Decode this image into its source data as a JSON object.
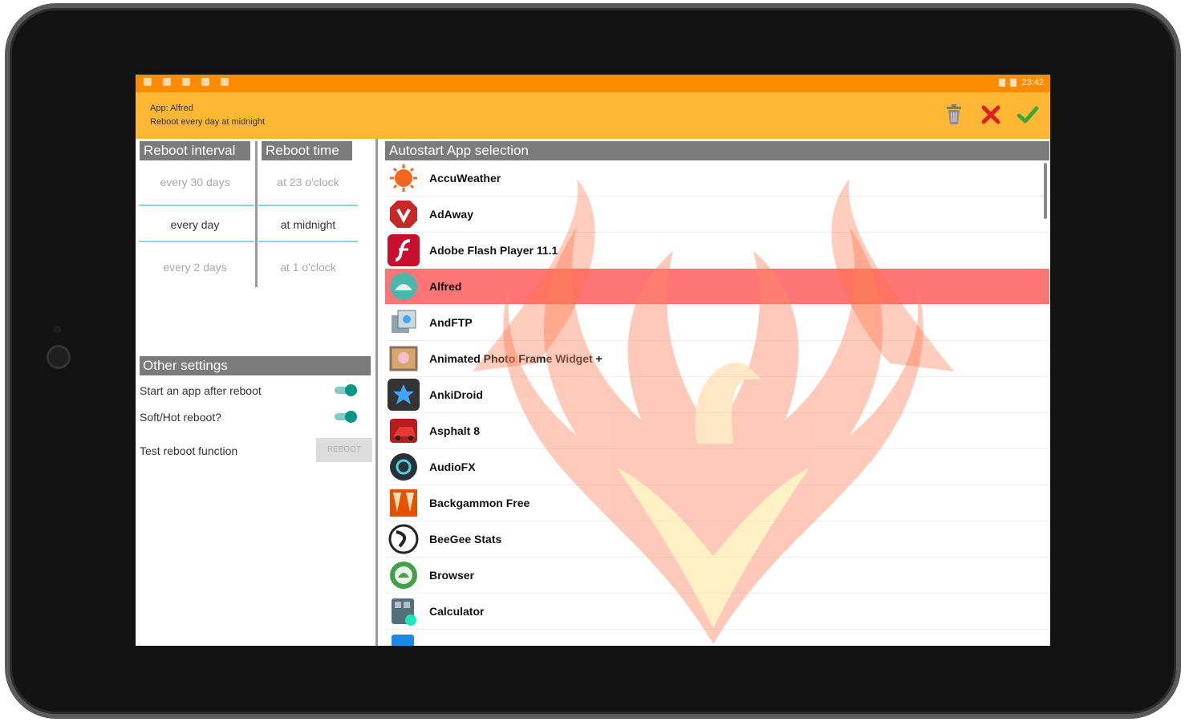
{
  "status_bar": {
    "time": "23:42"
  },
  "app_bar": {
    "line1": "App: Alfred",
    "line2": "Reboot every day at midnight",
    "actions": [
      "trash-icon",
      "close-icon",
      "check-icon"
    ],
    "colors": {
      "status": "#ff8c00",
      "toolbar": "#ffb734"
    }
  },
  "reboot_interval": {
    "header": "Reboot interval",
    "items": [
      "every 30 days",
      "every day",
      "every 2 days"
    ],
    "selected": "every day"
  },
  "reboot_time": {
    "header": "Reboot time",
    "items": [
      "at 23 o'clock",
      "at midnight",
      "at 1 o'clock"
    ],
    "selected": "at midnight"
  },
  "other_settings": {
    "header": "Other settings",
    "start_app_label": "Start an app after reboot",
    "soft_hot_label": "Soft/Hot reboot?",
    "test_label": "Test reboot function",
    "reboot_button": "REBOOT",
    "toggle_start_app": true,
    "toggle_soft_hot": true
  },
  "autostart": {
    "header": "Autostart App selection",
    "selected": "Alfred",
    "apps": [
      "AccuWeather",
      "AdAway",
      "Adobe Flash Player 11.1",
      "Alfred",
      "AndFTP",
      "Animated Photo Frame Widget +",
      "AnkiDroid",
      "Asphalt 8",
      "AudioFX",
      "Backgammon Free",
      "BeeGee Stats",
      "Browser",
      "Calculator"
    ]
  }
}
